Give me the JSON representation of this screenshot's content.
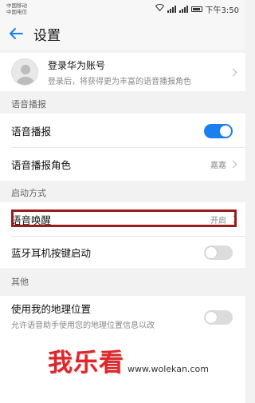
{
  "status_bar": {
    "carrier1": "中国移动",
    "carrier2": "中国电信",
    "time": "下午3:50"
  },
  "app_bar": {
    "title": "设置"
  },
  "account": {
    "title": "登录华为账号",
    "subtitle": "登录后，将获得更为丰富的语音播报角色"
  },
  "sections": {
    "broadcast": "语音播报",
    "startup": "启动方式",
    "other": "其他"
  },
  "rows": {
    "voice_broadcast": {
      "label": "语音播报",
      "toggle": "on"
    },
    "broadcast_role": {
      "label": "语音播报角色",
      "value": "嘉嘉"
    },
    "voice_wake": {
      "label": "语音唤醒",
      "value": "开启"
    },
    "bt_headset": {
      "label": "蓝牙耳机按键启动",
      "toggle": "off"
    },
    "location": {
      "label": "使用我的地理位置",
      "sub": "允许语音助手使用您的地理位置信息以改",
      "toggle": "off"
    }
  },
  "watermark": {
    "text": "我乐看",
    "url": "www.wolekan.com"
  },
  "colors": {
    "accent": "#1a7ff0",
    "highlight": "#9a1c1c",
    "watermark": "#e0262a"
  }
}
